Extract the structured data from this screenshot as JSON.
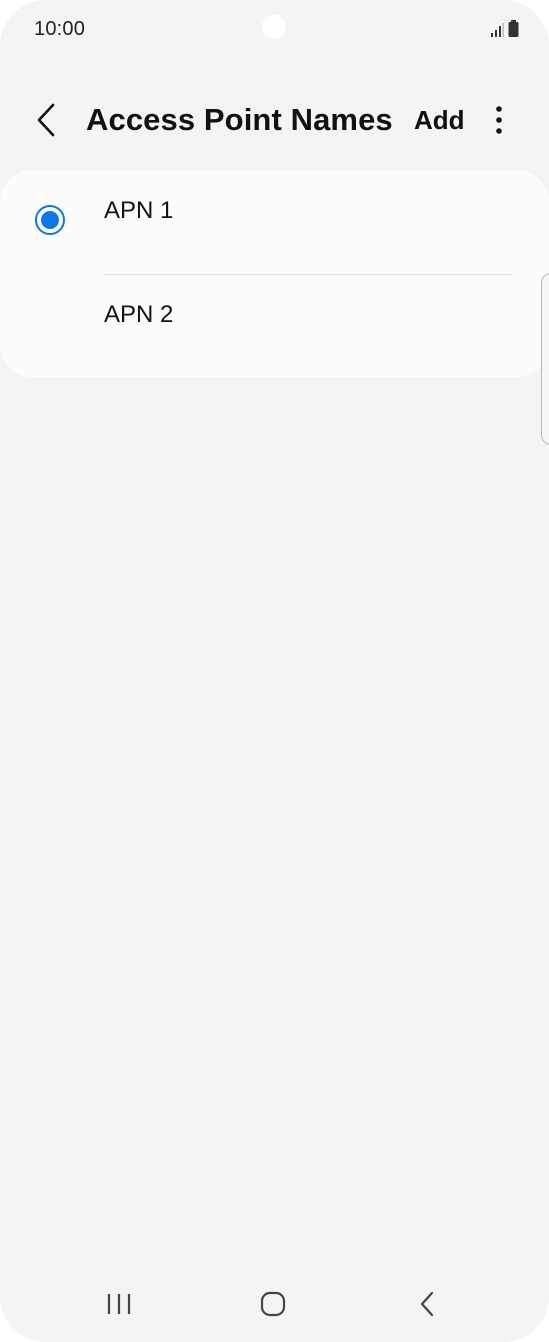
{
  "status_bar": {
    "time": "10:00",
    "icons": [
      "signal-icon",
      "battery-icon"
    ]
  },
  "app_bar": {
    "title": "Access Point Names",
    "add_label": "Add",
    "icons": [
      "back-arrow-icon",
      "more-options-icon"
    ]
  },
  "apn_list": [
    {
      "label": "APN 1",
      "selected": true
    },
    {
      "label": "APN 2",
      "selected": false
    }
  ],
  "nav_bar": {
    "icons": [
      "recent-apps-icon",
      "home-icon",
      "back-icon"
    ]
  },
  "colors": {
    "accent": "#0e77e6",
    "background": "#f4f4f4",
    "card": "#fcfcfc",
    "text": "#111111"
  }
}
